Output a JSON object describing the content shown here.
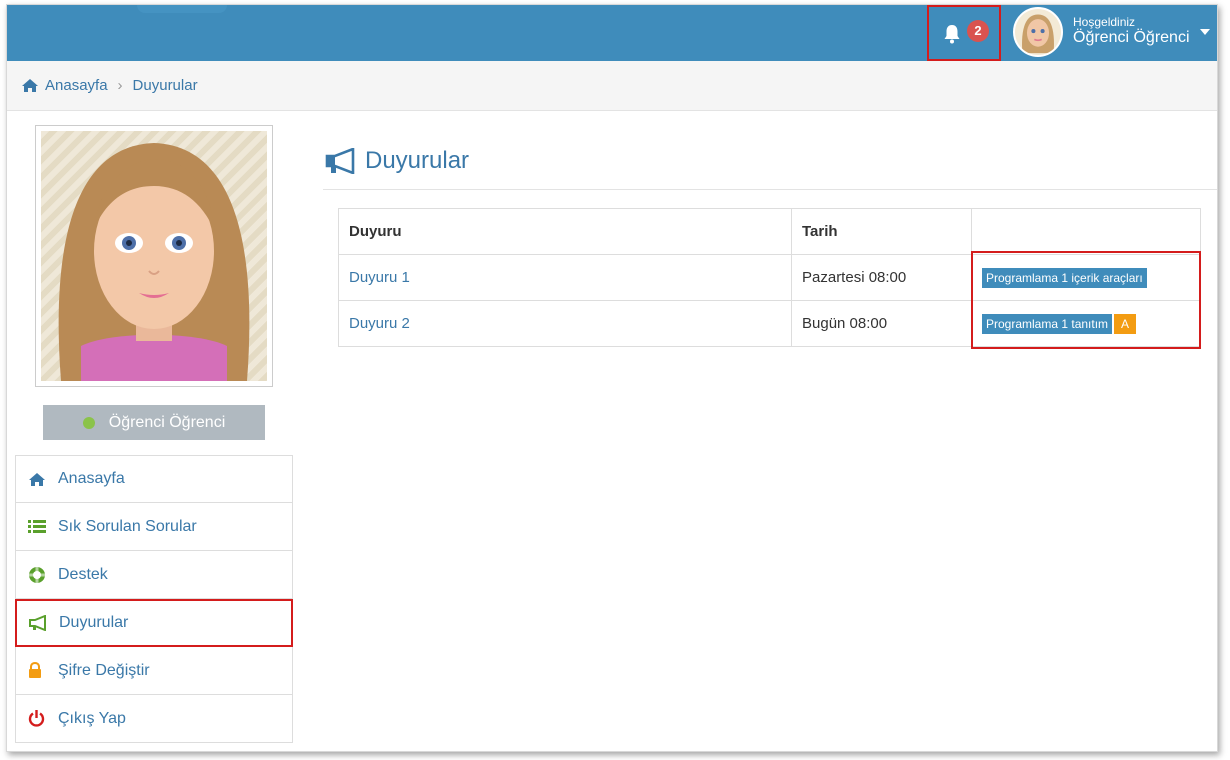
{
  "header": {
    "notification_count": "2",
    "welcome_line1": "Hoşgeldiniz",
    "welcome_line2": "Öğrenci Öğrenci"
  },
  "breadcrumb": {
    "home": "Anasayfa",
    "current": "Duyurular"
  },
  "profile": {
    "name": "Öğrenci Öğrenci",
    "status_color": "#8bc34a"
  },
  "sidebar": {
    "items": [
      {
        "label": "Anasayfa",
        "icon": "home-icon"
      },
      {
        "label": "Sık Sorulan Sorular",
        "icon": "list-icon"
      },
      {
        "label": "Destek",
        "icon": "lifebuoy-icon"
      },
      {
        "label": "Duyurular",
        "icon": "bullhorn-icon",
        "active": true
      },
      {
        "label": "Şifre Değiştir",
        "icon": "lock-icon"
      },
      {
        "label": "Çıkış Yap",
        "icon": "power-icon"
      }
    ]
  },
  "main": {
    "title": "Duyurular",
    "table": {
      "headers": [
        "Duyuru",
        "Tarih",
        ""
      ],
      "rows": [
        {
          "title": "Duyuru 1",
          "date": "Pazartesi 08:00",
          "tag": "Programlama 1 içerik araçları",
          "extra": ""
        },
        {
          "title": "Duyuru 2",
          "date": "Bugün 08:00",
          "tag": "Programlama 1 tanıtım",
          "extra": "A"
        }
      ]
    }
  },
  "colors": {
    "topbar": "#3f8cbb",
    "link": "#3a78a8",
    "highlight": "#d41c1c",
    "tag": "#3f8cbb",
    "tag_extra": "#f39c12"
  }
}
